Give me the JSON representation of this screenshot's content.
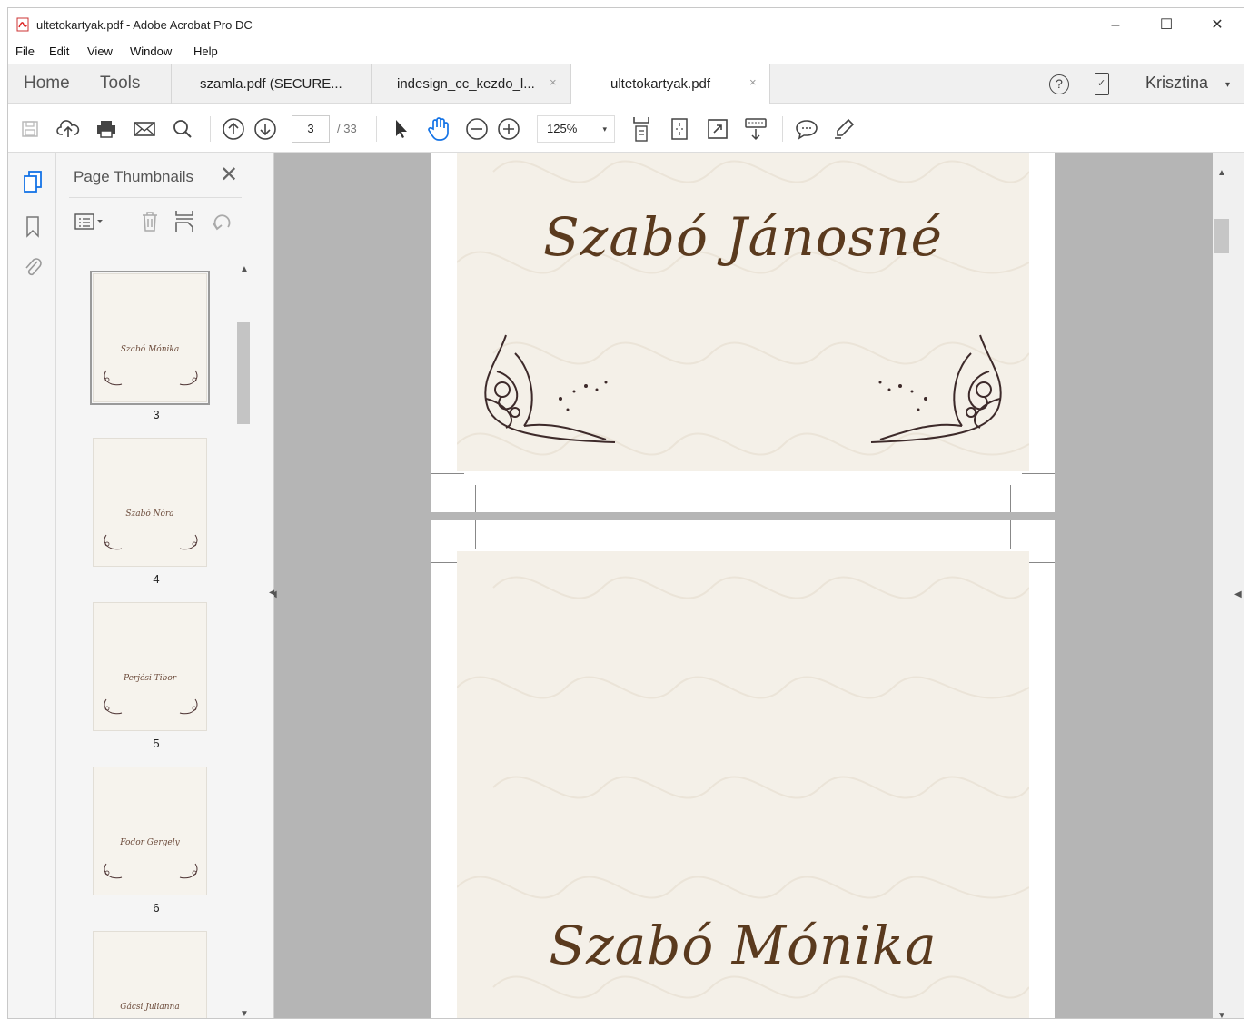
{
  "window": {
    "title": "ultetokartyak.pdf - Adobe Acrobat Pro DC",
    "minimize": "–",
    "maximize": "☐",
    "close": "✕"
  },
  "menu": [
    "File",
    "Edit",
    "View",
    "Window",
    "Help"
  ],
  "tabs": {
    "home": "Home",
    "tools": "Tools",
    "documents": [
      {
        "label": "szamla.pdf (SECURE...",
        "close": ""
      },
      {
        "label": "indesign_cc_kezdo_l...",
        "close": "×"
      },
      {
        "label": "ultetokartyak.pdf",
        "close": "×",
        "active": true
      }
    ],
    "help": "?",
    "user": "Krisztina",
    "user_dropdown": "▾"
  },
  "toolbar": {
    "current_page": "3",
    "total_pages": "/ 33",
    "zoom": "125%",
    "zoom_dropdown": "▾"
  },
  "thumbnails_panel": {
    "title": "Page Thumbnails",
    "close": "✕",
    "pages": [
      {
        "number": "3",
        "name": "Szabó Mónika",
        "selected": true
      },
      {
        "number": "4",
        "name": "Szabó Nóra"
      },
      {
        "number": "5",
        "name": "Perjési Tibor"
      },
      {
        "number": "6",
        "name": "Fodor Gergely"
      },
      {
        "number": "",
        "name": "Gácsi Julianna"
      }
    ]
  },
  "document": {
    "card_top_name": "Szabó Jánosné",
    "card_bottom_name": "Szabó Mónika"
  },
  "colors": {
    "card_background": "#f4f0e8",
    "name_text": "#5a3a1e",
    "canvas": "#b5b5b5"
  }
}
